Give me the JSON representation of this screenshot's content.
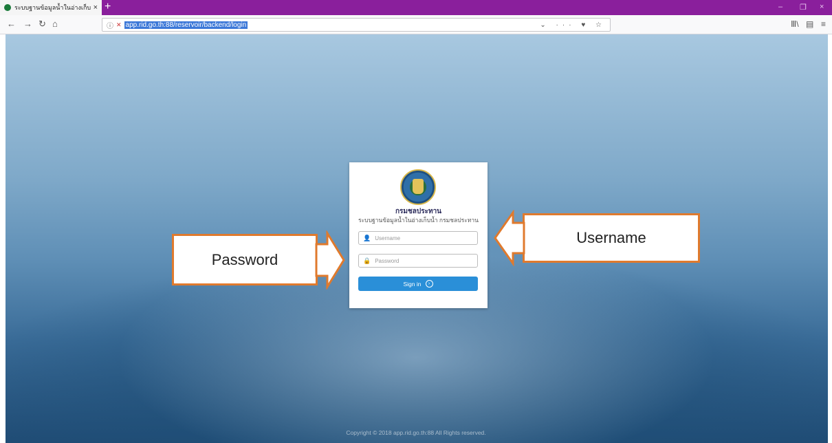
{
  "browser": {
    "tab_title": "ระบบฐานข้อมูลน้ำในอ่างเก็บน้ำ กร",
    "tab_close": "×",
    "new_tab": "+",
    "window_controls": [
      "–",
      "❐",
      "×"
    ],
    "nav": {
      "back": "←",
      "forward": "→",
      "reload": "↻",
      "home": "⌂"
    },
    "url_info": "ⓘ",
    "url_secure_icon": "✕",
    "url": "app.rid.go.th:88/reservoir/backend/login",
    "url_actions": "⌄ ··· ♥ ☆",
    "toolbar_icons": [
      "Ⅲ\\",
      "▤",
      "≡"
    ]
  },
  "login": {
    "org_name": "กรมชลประทาน",
    "system_name": "ระบบฐานข้อมูลน้ำในอ่างเก็บน้ำ กรมชลประทาน",
    "username_placeholder": "Username",
    "password_placeholder": "Password",
    "signin_label": "Sign in",
    "signin_icon": "›",
    "user_icon": "👤",
    "lock_icon": "🔒"
  },
  "annotations": {
    "password": "Password",
    "username": "Username"
  },
  "footer": {
    "copyright": "Copyright © 2018 app.rid.go.th:88 All Rights reserved."
  },
  "colors": {
    "tabbar": "#8a1f9c",
    "callout_border": "#e07a2d",
    "signin": "#2a8fd8"
  }
}
